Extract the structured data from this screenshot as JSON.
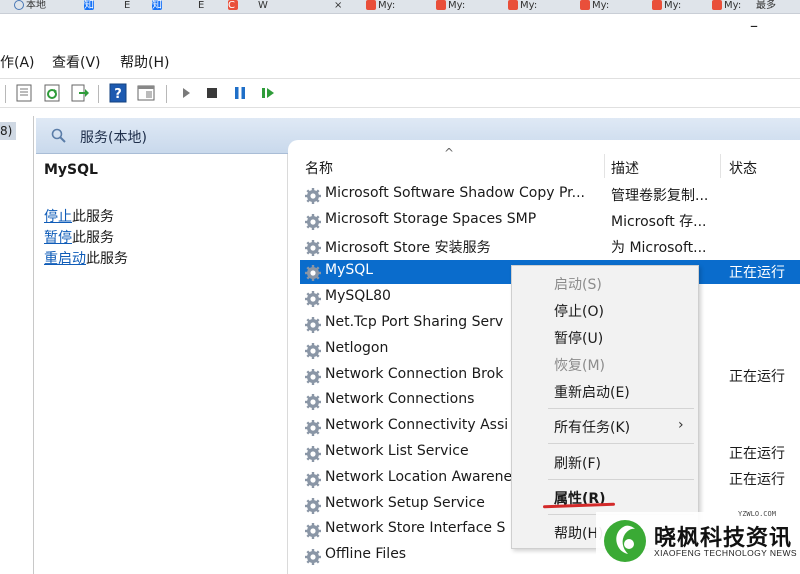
{
  "taskbar": {
    "items": [
      "本地",
      "知",
      "Ë",
      "知",
      "Ë",
      "C",
      "W",
      "×",
      "My:",
      "My:",
      "My:",
      "My:",
      "My:",
      "My:",
      "最多"
    ]
  },
  "window": {
    "minimize_label": "–"
  },
  "menu": {
    "items": [
      "作(A)",
      "查看(V)",
      "帮助(H)"
    ]
  },
  "toolbar": {
    "icons": [
      "properties-icon",
      "refresh-icon",
      "export-icon",
      "help-icon",
      "show-hide-icon",
      "play-icon",
      "stop-icon",
      "pause-icon",
      "restart-icon"
    ]
  },
  "tree": {
    "partial_label": "8)"
  },
  "header": {
    "title": "服务(本地)"
  },
  "detail": {
    "service_name": "MySQL",
    "stop_link": "停止",
    "stop_rest": "此服务",
    "pause_link": "暂停",
    "pause_rest": "此服务",
    "restart_link": "重启动",
    "restart_rest": "此服务"
  },
  "list": {
    "sort_caret": "^",
    "columns": {
      "name": "名称",
      "description": "描述",
      "status": "状态"
    },
    "rows": [
      {
        "name": "Microsoft Software Shadow Copy Pr...",
        "desc": "管理卷影复制...",
        "status": ""
      },
      {
        "name": "Microsoft Storage Spaces SMP",
        "desc": "Microsoft 存...",
        "status": ""
      },
      {
        "name": "Microsoft Store 安装服务",
        "desc": "为 Microsoft...",
        "status": ""
      },
      {
        "name": "MySQL",
        "desc": "",
        "status": "正在运行"
      },
      {
        "name": "MySQL80",
        "desc": "...",
        "status": ""
      },
      {
        "name": "Net.Tcp Port Sharing Serv",
        "desc": "...",
        "status": ""
      },
      {
        "name": "Netlogon",
        "desc": "...",
        "status": ""
      },
      {
        "name": "Network Connection Brok",
        "desc": "v...",
        "status": "正在运行"
      },
      {
        "name": "Network Connections",
        "desc": "...",
        "status": ""
      },
      {
        "name": "Network Connectivity Assi",
        "desc": "...",
        "status": ""
      },
      {
        "name": "Network List Service",
        "desc": "",
        "status": "正在运行"
      },
      {
        "name": "Network Location Awarene",
        "desc": "",
        "status": "正在运行"
      },
      {
        "name": "Network Setup Service",
        "desc": "",
        "status": ""
      },
      {
        "name": "Network Store Interface S",
        "desc": "",
        "status": ""
      },
      {
        "name": "Offline Files",
        "desc": "",
        "status": ""
      }
    ]
  },
  "context_menu": {
    "start": "启动(S)",
    "stop": "停止(O)",
    "pause": "暂停(U)",
    "resume": "恢复(M)",
    "restart": "重新启动(E)",
    "all_tasks": "所有任务(K)",
    "submenu_arrow": "›",
    "refresh": "刷新(F)",
    "properties": "属性(R)",
    "help": "帮助(H)"
  },
  "watermark": {
    "url": "YZWLO.COM",
    "cn": "晓枫科技资讯",
    "en": "XIAOFENG TECHNOLOGY NEWS"
  },
  "colors": {
    "selection": "#0a6ccc",
    "link": "#0f5cb8",
    "highlight_underline": "#d32a2a",
    "watermark_green": "#3aaa35"
  }
}
